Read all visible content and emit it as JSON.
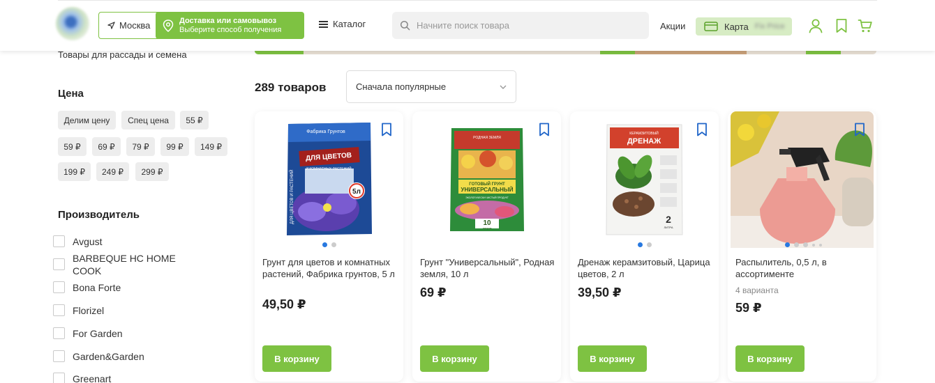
{
  "header": {
    "city": "Москва",
    "delivery_title": "Доставка или самовывоз",
    "delivery_sub": "Выберите способ получения",
    "catalog": "Каталог",
    "search_placeholder": "Начните поиск товара",
    "promo": "Акции",
    "card_label": "Карта",
    "card_blurred": "Fix Price",
    "icons": [
      "navigation-arrow-icon",
      "map-pin-icon",
      "burger-menu-icon",
      "search-icon",
      "loyalty-card-icon",
      "user-icon",
      "bookmark-icon",
      "cart-icon"
    ],
    "accent_color": "#7ec242"
  },
  "sidebar": {
    "category_link": "Товары для рассады и семена",
    "price_title": "Цена",
    "price_chips": [
      "Делим цену",
      "Спец цена",
      "55 ₽",
      "59 ₽",
      "69 ₽",
      "79 ₽",
      "99 ₽",
      "149 ₽",
      "199 ₽",
      "249 ₽",
      "299 ₽"
    ],
    "brand_title": "Производитель",
    "brands": [
      "Avgust",
      "BARBEQUE HC HOME COOK",
      "Bona Forte",
      "Florizel",
      "For Garden",
      "Garden&Garden",
      "Greenart"
    ]
  },
  "main": {
    "count": "289 товаров",
    "sort": "Сначала популярные",
    "products": [
      {
        "name": "Грунт для цветов и комнатных растений, Фабрика грунтов, 5 л",
        "price": "49,50 ₽",
        "button": "В корзину",
        "variants": ""
      },
      {
        "name": "Грунт \"Универсальный\", Родная земля, 10 л",
        "price": "69 ₽",
        "button": "В корзину",
        "variants": ""
      },
      {
        "name": "Дренаж керамзитовый, Царица цветов, 2 л",
        "price": "39,50 ₽",
        "button": "В корзину",
        "variants": ""
      },
      {
        "name": "Распылитель, 0,5 л, в ассортименте",
        "price": "59 ₽",
        "button": "В корзину",
        "variants": "4 варианта"
      }
    ],
    "package_texts": {
      "p1_brand": "Фабрика Грунтов",
      "p1_title": "ДЛЯ ЦВЕТОВ",
      "p1_sub": "И КОМНАТНЫХ РАСТЕНИЙ",
      "p1_side": "ДЛЯ ЦВЕТОВ И РАСТЕНИЙ",
      "p1_volume": "5л",
      "p2_brand": "РОДНАЯ ЗЕМЛЯ",
      "p2_title": "ГОТОВЫЙ ГРУНТ",
      "p2_big": "УНИВЕРСАЛЬНЫЙ",
      "p2_eco": "ЭКОЛОГИЧЕСКИ ЧИСТЫЙ ПРОДУКТ",
      "p2_volume": "10",
      "p2_unit": "литров",
      "p3_top": "КЕРАМЗИТОВЫЙ",
      "p3_title": "ДРЕНАЖ",
      "p3_volume": "2",
      "p3_unit": "ЛИТРА"
    }
  }
}
